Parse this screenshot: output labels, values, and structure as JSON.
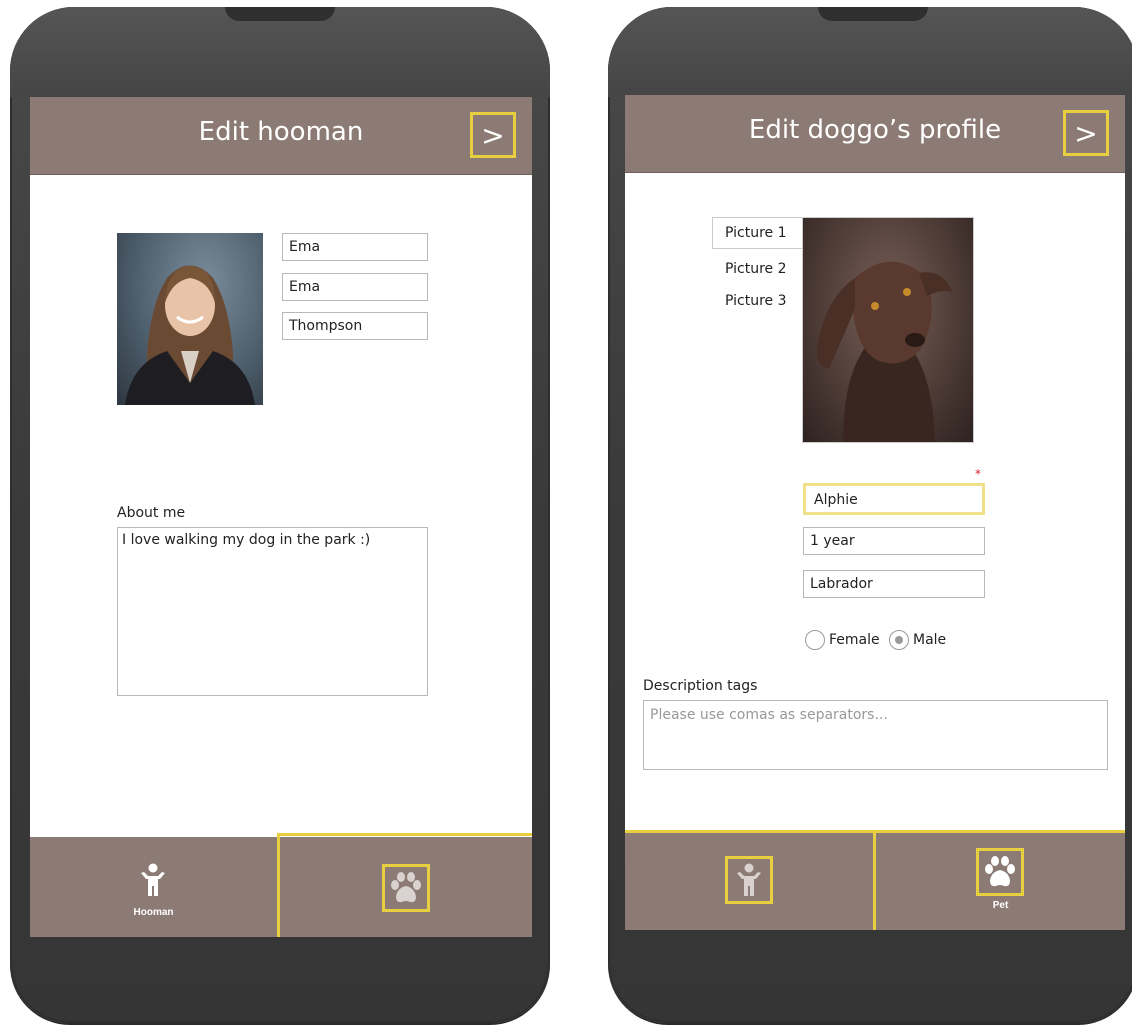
{
  "left_screen": {
    "title": "Edit hooman",
    "next_label": ">",
    "first_name": "Ema",
    "display_name": "Ema",
    "last_name": "Thompson",
    "about_label": "About me",
    "about_text": "I love walking my dog in the park :)",
    "tabs": [
      {
        "label": "Hooman",
        "icon": "person-icon",
        "active": true
      },
      {
        "label": "",
        "icon": "paw-icon",
        "active": false
      }
    ]
  },
  "right_screen": {
    "title": "Edit doggo’s profile",
    "next_label": ">",
    "picture_tabs": [
      "Picture 1",
      "Picture 2",
      "Picture 3"
    ],
    "required_marker": "*",
    "name": "Alphie",
    "age": "1 year",
    "breed": "Labrador",
    "gender_options": [
      "Female",
      "Male"
    ],
    "gender_selected": "Male",
    "tags_label": "Description tags",
    "tags_placeholder": "Please use comas as separators...",
    "tabs": [
      {
        "label": "",
        "icon": "person-icon",
        "active": false
      },
      {
        "label": "Pet",
        "icon": "paw-icon",
        "active": true
      }
    ]
  },
  "colors": {
    "header": "#8c7b74",
    "accent": "#e8cf40",
    "device": "#3f3f3f"
  }
}
